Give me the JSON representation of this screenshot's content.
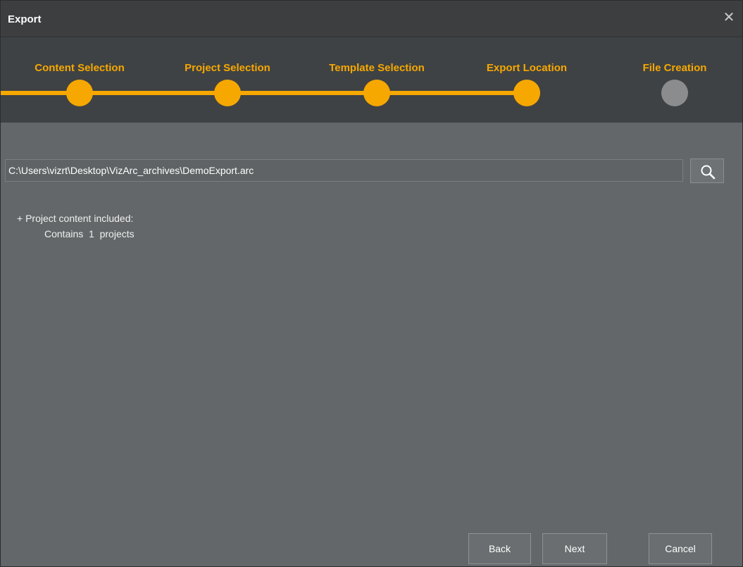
{
  "window": {
    "title": "Export",
    "close_glyph": "✕"
  },
  "wizard": {
    "steps": [
      {
        "label": "Content Selection",
        "state": "complete"
      },
      {
        "label": "Project Selection",
        "state": "complete"
      },
      {
        "label": "Template Selection",
        "state": "complete"
      },
      {
        "label": "Export Location",
        "state": "current"
      },
      {
        "label": "File Creation",
        "state": "pending"
      }
    ],
    "accent_color": "#f7a800",
    "inactive_color": "#8a8c8e"
  },
  "export_location": {
    "path_value": "C:\\Users\\vizrt\\Desktop\\VizArc_archives\\DemoExport.arc",
    "browse_icon": "search-icon"
  },
  "summary": {
    "heading": "+ Project content included:",
    "detail": "Contains  1  projects"
  },
  "buttons": {
    "back": "Back",
    "next": "Next",
    "cancel": "Cancel"
  }
}
